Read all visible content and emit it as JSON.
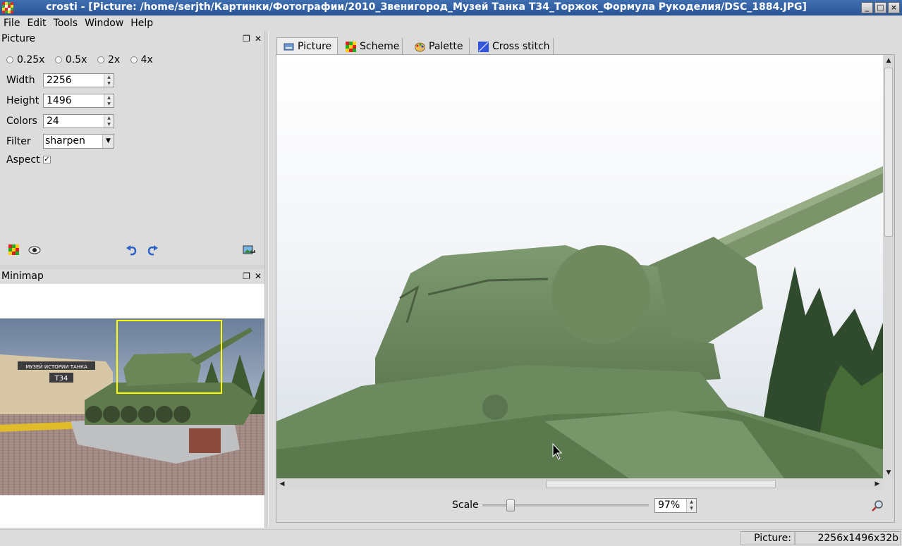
{
  "window": {
    "title": "crosti - [Picture: /home/serjth/Картинки/Фотографии/2010_Звенигород_Музей Танка Т34_Торжок_Формула Рукоделия/DSC_1884.JPG]",
    "buttons": [
      "_",
      "□",
      "×"
    ]
  },
  "menu": [
    "File",
    "Edit",
    "Tools",
    "Window",
    "Help"
  ],
  "picture_panel": {
    "title": "Picture",
    "scale_options": [
      "0.25x",
      "0.5x",
      "2x",
      "4x"
    ],
    "width_label": "Width",
    "width_value": "2256",
    "height_label": "Height",
    "height_value": "1496",
    "colors_label": "Colors",
    "colors_value": "24",
    "filter_label": "Filter",
    "filter_value": "sharpen",
    "aspect_label": "Aspect",
    "aspect_checked": true,
    "aspect_mark": "✓"
  },
  "minimap_panel": {
    "title": "Minimap",
    "sign_line1": "МУЗЕЙ ИСТОРИИ ТАНКА",
    "sign_line2": "Т34"
  },
  "tabs": [
    {
      "label": "Picture",
      "active": true
    },
    {
      "label": "Scheme",
      "active": false
    },
    {
      "label": "Palette",
      "active": false
    },
    {
      "label": "Cross stitch",
      "active": false
    }
  ],
  "zoom": {
    "label": "Scale",
    "value": "97%",
    "slider_fraction": 0.17
  },
  "status": {
    "label": "Picture:",
    "value": "2256x1496x32b"
  },
  "colors": {
    "titlebar": "#2f5d9f",
    "tank_green": "#6f8c62",
    "minimap_frame": "#ffff00"
  }
}
